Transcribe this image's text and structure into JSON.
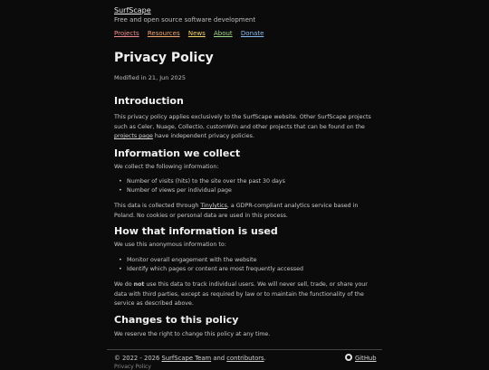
{
  "site": {
    "title": "SurfScape",
    "tagline": "Free and open source software development"
  },
  "nav": [
    {
      "label": "Projects",
      "color": "#f08c8c"
    },
    {
      "label": "Resources",
      "color": "#f2a86a"
    },
    {
      "label": "News",
      "color": "#f2d66a"
    },
    {
      "label": "About",
      "color": "#9fd98a"
    },
    {
      "label": "Donate",
      "color": "#8ab8f0"
    }
  ],
  "page": {
    "title": "Privacy Policy",
    "modified": "Modified in 21, Jun 2025"
  },
  "intro": {
    "heading": "Introduction",
    "text_before_link": "This privacy policy applies exclusively to the SurfScape website. Other SurfScape projects such as Celer, Nuage, Collectio, customWin and other projects that can be found on the ",
    "link": "projects page",
    "text_after_link": " have independent privacy policies."
  },
  "collect": {
    "heading": "Information we collect",
    "lead": "We collect the following information:",
    "items": [
      "Number of visits (hits) to the site over the past 30 days",
      "Number of views per individual page"
    ],
    "text_before_link": "This data is collected through ",
    "link": "Tinylytics",
    "text_after_link": ", a GDPR-compliant analytics service based in Poland. No cookies or personal data are used in this process."
  },
  "usage": {
    "heading": "How that information is used",
    "lead": "We use this anonymous information to:",
    "items": [
      "Monitor overall engagement with the website",
      "Identify which pages or content are most frequently accessed"
    ],
    "text_before_bold": "We do ",
    "bold": "not",
    "text_after_bold": " use this data to track individual users. We will never sell, trade, or share your data with third parties, except as required by law or to maintain the functionality of the service as described above."
  },
  "changes": {
    "heading": "Changes to this policy",
    "text": "We reserve the right to change this policy at any time."
  },
  "footer": {
    "copyright": "© 2022 - 2026 ",
    "team_link": "SurfScape Team",
    "and": " and ",
    "contributors_link": "contributors",
    "period": ".",
    "github": "GitHub",
    "sub": "Privacy Policy"
  }
}
